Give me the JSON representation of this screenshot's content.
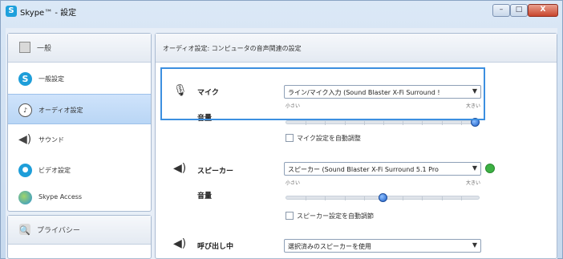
{
  "window": {
    "title": "Skype™ - 設定",
    "icon": "skype-logo-icon",
    "controls": {
      "minimize": "–",
      "maximize": "□",
      "close": "X"
    }
  },
  "sidebar": {
    "sections": [
      {
        "header": "一般",
        "header_icon": "general-icon",
        "items": [
          {
            "label": "一般設定",
            "icon": "skype-icon",
            "active": false
          },
          {
            "label": "オーディオ設定",
            "icon": "audio-settings-icon",
            "active": true
          },
          {
            "label": "サウンド",
            "icon": "speaker-icon",
            "active": false
          },
          {
            "label": "ビデオ設定",
            "icon": "video-icon",
            "active": false
          },
          {
            "label": "Skype Access",
            "icon": "skype-access-icon",
            "active": false
          }
        ]
      },
      {
        "header": "プライバシー",
        "header_icon": "privacy-icon",
        "items": []
      }
    ]
  },
  "main": {
    "header": "オーディオ設定: コンピュータの音声関連の設定",
    "microphone": {
      "label": "マイク",
      "device": "ライン/マイク入力 (Sound Blaster X-Fi Surround !",
      "volume_label": "音量",
      "slider_min": "小さい",
      "slider_max": "大きい",
      "level": 1.0,
      "auto_adjust": "マイク設定を自動調整",
      "auto_adjust_checked": false
    },
    "speaker": {
      "label": "スピーカー",
      "device": "スピーカー (Sound Blaster X-Fi Surround 5.1 Pro",
      "volume_label": "音量",
      "slider_min": "小さい",
      "slider_max": "大きい",
      "level": 0.5,
      "auto_adjust": "スピーカー設定を自動調節",
      "auto_adjust_checked": false,
      "status_color": "#3cb043"
    },
    "ringing": {
      "label": "呼び出し中",
      "device": "選択済みのスピーカーを使用"
    }
  },
  "colors": {
    "highlight_border": "#3c8fe0",
    "active_nav": "#b9d6f5",
    "slider_thumb": "#1c5fc8"
  }
}
